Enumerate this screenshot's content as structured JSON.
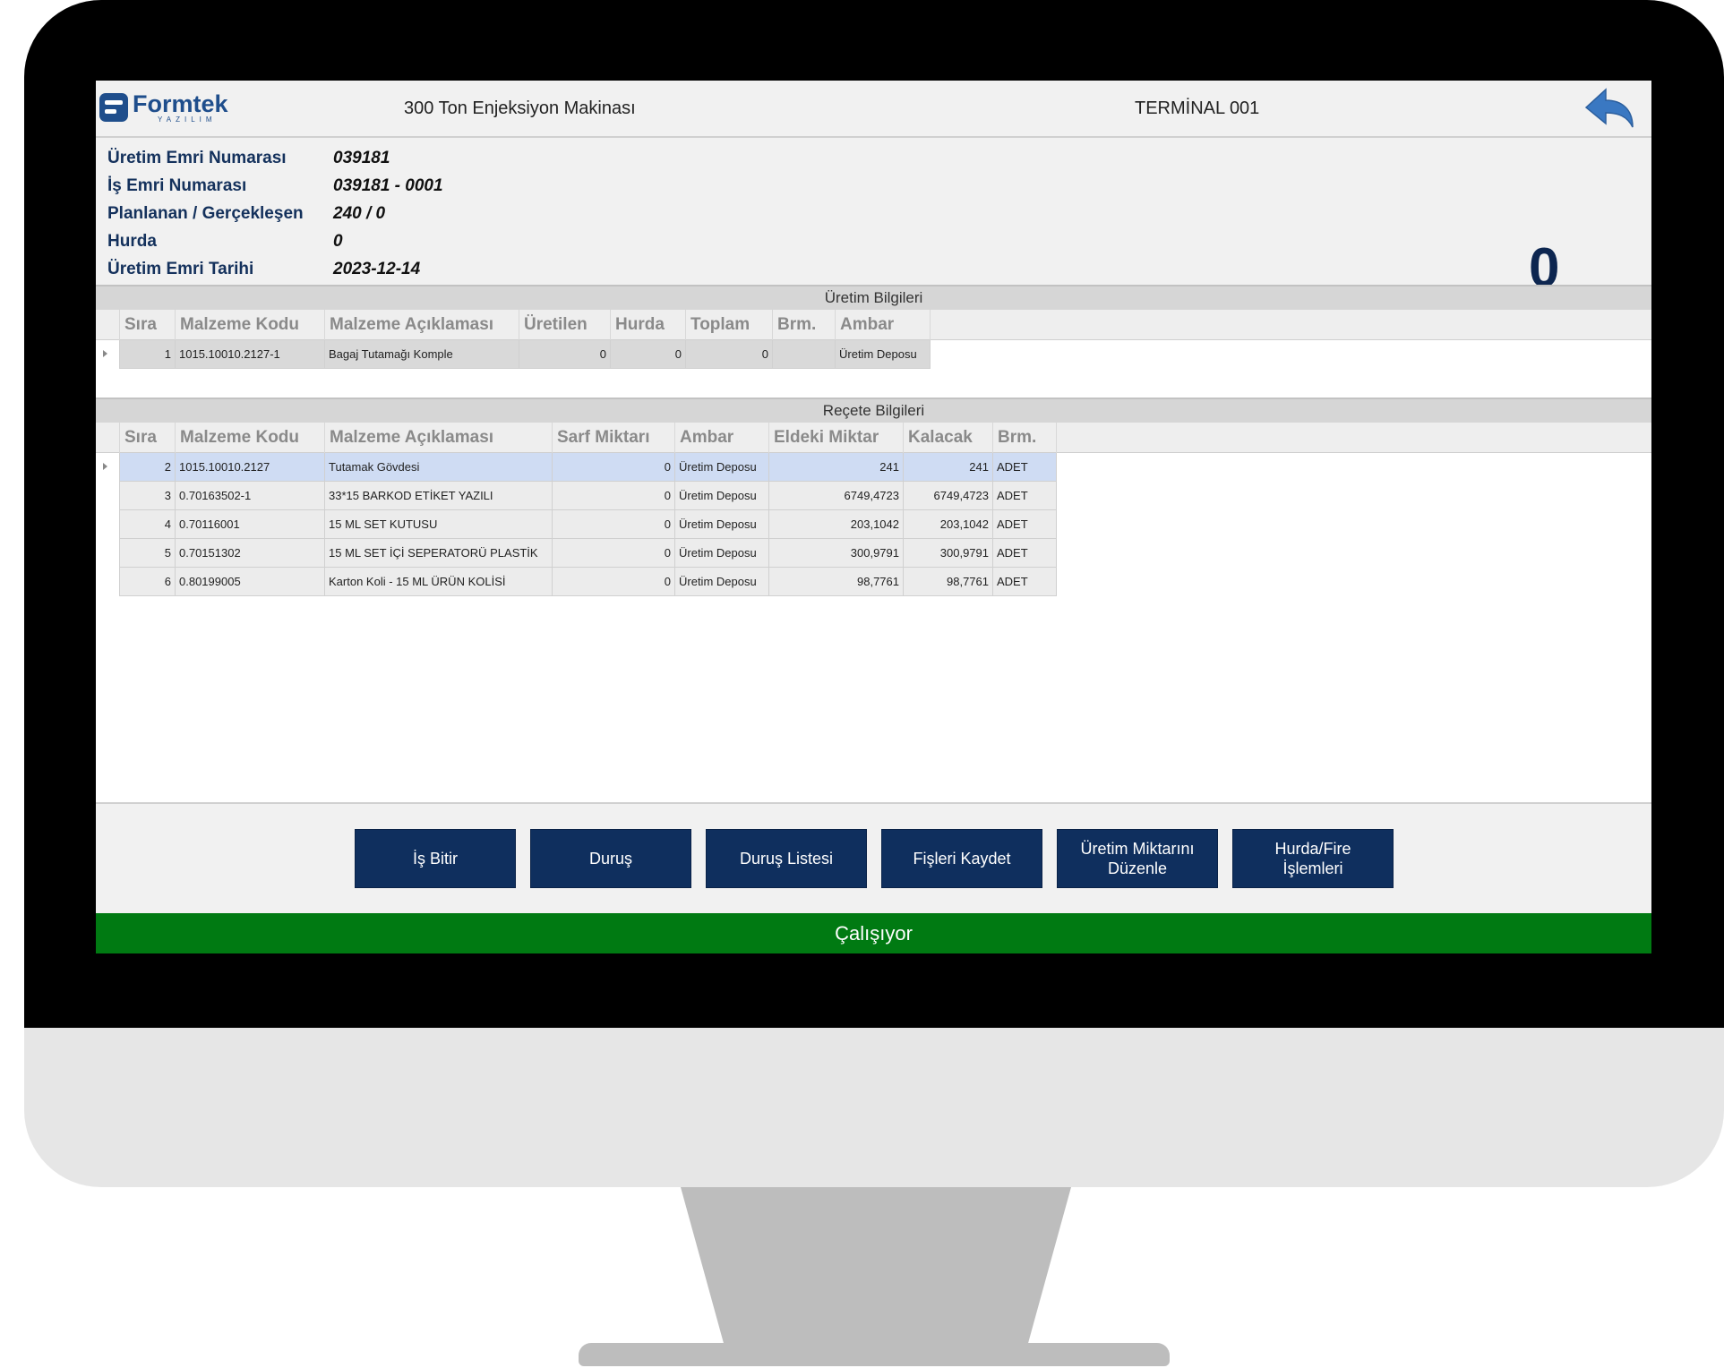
{
  "header": {
    "logo_brand": "Formtek",
    "logo_sub": "YAZILIM",
    "machine_title": "300 Ton Enjeksiyon Makinası",
    "terminal_title": "TERMİNAL 001",
    "back_icon": "back-arrow-icon",
    "accent_color": "#1f4e8c"
  },
  "info": {
    "rows": [
      {
        "label": "Üretim Emri Numarası",
        "value": "039181"
      },
      {
        "label": "İş Emri Numarası",
        "value": "039181 - 0001"
      },
      {
        "label": "Planlanan / Gerçekleşen",
        "value": "240 / 0"
      },
      {
        "label": "Hurda",
        "value": "0"
      },
      {
        "label": "Üretim Emri Tarihi",
        "value": "2023-12-14"
      }
    ],
    "counter": "0"
  },
  "production": {
    "title": "Üretim Bilgileri",
    "columns": [
      "Sıra",
      "Malzeme Kodu",
      "Malzeme Açıklaması",
      "Üretilen",
      "Hurda",
      "Toplam",
      "Brm.",
      "Ambar"
    ],
    "rows": [
      [
        "1",
        "1015.10010.2127-1",
        "Bagaj Tutamağı Komple",
        "0",
        "0",
        "0",
        "",
        "Üretim Deposu"
      ]
    ]
  },
  "recipe": {
    "title": "Reçete Bilgileri",
    "columns": [
      "Sıra",
      "Malzeme Kodu",
      "Malzeme Açıklaması",
      "Sarf Miktarı",
      "Ambar",
      "Eldeki Miktar",
      "Kalacak",
      "Brm."
    ],
    "rows": [
      [
        "2",
        "1015.10010.2127",
        "Tutamak Gövdesi",
        "0",
        "Üretim Deposu",
        "241",
        "241",
        "ADET"
      ],
      [
        "3",
        "0.70163502-1",
        "33*15  BARKOD  ETİKET YAZILI",
        "0",
        "Üretim Deposu",
        "6749,4723",
        "6749,4723",
        "ADET"
      ],
      [
        "4",
        "0.70116001",
        "15 ML SET KUTUSU",
        "0",
        "Üretim Deposu",
        "203,1042",
        "203,1042",
        "ADET"
      ],
      [
        "5",
        "0.70151302",
        "15 ML SET İÇİ SEPERATORÜ PLASTİK",
        "0",
        "Üretim Deposu",
        "300,9791",
        "300,9791",
        "ADET"
      ],
      [
        "6",
        "0.80199005",
        "Karton Koli - 15 ML ÜRÜN KOLİSİ",
        "0",
        "Üretim Deposu",
        "98,7761",
        "98,7761",
        "ADET"
      ]
    ]
  },
  "buttons": [
    {
      "label": "İş Bitir"
    },
    {
      "label": "Duruş"
    },
    {
      "label": "Duruş Listesi"
    },
    {
      "label": "Fişleri Kaydet"
    },
    {
      "label": "Üretim Miktarını\nDüzenle"
    },
    {
      "label": "Hurda/Fire\nİşlemleri"
    }
  ],
  "status": {
    "text": "Çalışıyor",
    "color": "#007a12"
  }
}
